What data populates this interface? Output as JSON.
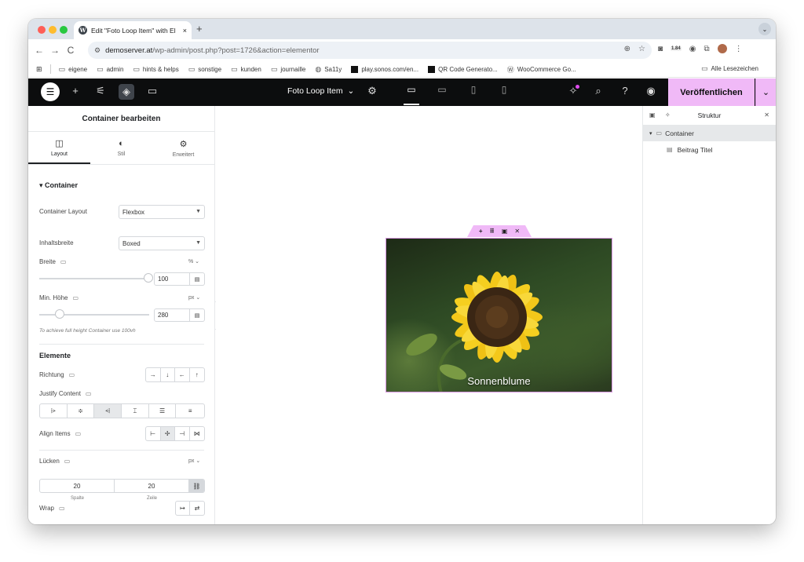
{
  "browser": {
    "tab_title": "Edit \"Foto Loop Item\" with El",
    "tab_close": "×",
    "new_tab": "+",
    "tab_menu": "⌄",
    "nav": {
      "back": "←",
      "forward": "→",
      "reload": "C"
    },
    "url_host": "demoserver.at",
    "url_rest": "/wp-admin/post.php?post=1726&action=elementor",
    "extension_badge": "1.84",
    "bookmarks": [
      {
        "label": "eigene",
        "icon": "folder-icon"
      },
      {
        "label": "admin",
        "icon": "folder-icon"
      },
      {
        "label": "hints & helps",
        "icon": "folder-icon"
      },
      {
        "label": "sonstige",
        "icon": "folder-icon"
      },
      {
        "label": "kunden",
        "icon": "folder-icon"
      },
      {
        "label": "journaille",
        "icon": "folder-icon"
      },
      {
        "label": "Sa11y",
        "icon": "globe-icon"
      },
      {
        "label": "play.sonos.com/en...",
        "icon": "sonos-icon"
      },
      {
        "label": "QR Code Generato...",
        "icon": "qr-icon"
      },
      {
        "label": "WooCommerce Go...",
        "icon": "wordpress-icon"
      }
    ],
    "bookmarks_right": "Alle Lesezeichen"
  },
  "editor": {
    "document_title": "Foto Loop Item",
    "publish_label": "Veröffentlichen",
    "accent": "#f0b9f7"
  },
  "panel": {
    "title": "Container bearbeiten",
    "tabs": [
      {
        "label": "Layout",
        "icon": "layout-icon"
      },
      {
        "label": "Stil",
        "icon": "style-icon"
      },
      {
        "label": "Erweitert",
        "icon": "gear-icon"
      }
    ],
    "section_container": "Container",
    "container_layout_label": "Container Layout",
    "container_layout_value": "Flexbox",
    "content_width_label": "Inhaltsbreite",
    "content_width_value": "Boxed",
    "width_label": "Breite",
    "width_unit": "% ⌄",
    "width_value": "100",
    "min_height_label": "Min. Höhe",
    "min_height_unit": "px ⌄",
    "min_height_value": "280",
    "min_height_hint": "To achieve full height Container use 100vh",
    "section_elements": "Elemente",
    "direction_label": "Richtung",
    "justify_label": "Justify Content",
    "align_label": "Align Items",
    "gaps_label": "Lücken",
    "gaps_unit": "px ⌄",
    "gap_column": "20",
    "gap_row": "20",
    "gap_column_label": "Spalte",
    "gap_row_label": "Zeile",
    "wrap_label": "Wrap"
  },
  "canvas": {
    "caption": "Sonnenblume"
  },
  "structure": {
    "title": "Struktur",
    "nodes": [
      {
        "label": "Container"
      },
      {
        "label": "Beitrag Titel"
      }
    ]
  }
}
